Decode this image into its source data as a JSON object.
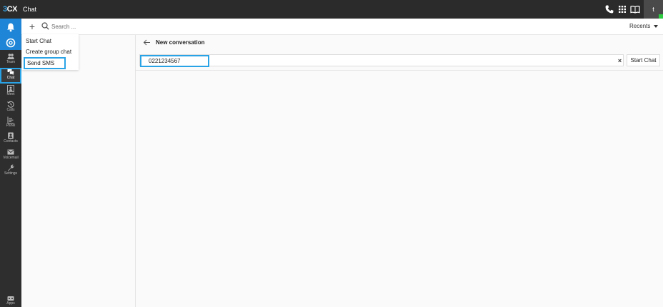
{
  "topbar": {
    "logo_prefix": "3",
    "logo_suffix": "CX",
    "title": "Chat",
    "user_initial": "t",
    "icons": [
      "phone-icon",
      "dialpad-icon",
      "book-icon"
    ]
  },
  "rail": {
    "items": [
      {
        "label": "Team",
        "icon": "team-icon"
      },
      {
        "label": "Chat",
        "icon": "chat-icon"
      },
      {
        "label": "Meet",
        "icon": "meet-icon"
      },
      {
        "label": "Calls",
        "icon": "history-icon"
      },
      {
        "label": "Panel",
        "icon": "panel-icon"
      },
      {
        "label": "Contacts",
        "icon": "contacts-icon"
      },
      {
        "label": "Voicemail",
        "icon": "voicemail-icon"
      },
      {
        "label": "Settings",
        "icon": "wrench-icon"
      }
    ],
    "apps_label": "Apps"
  },
  "search": {
    "placeholder": "Search ..."
  },
  "recents_label": "Recents",
  "dropdown": {
    "items": [
      "Start Chat",
      "Create group chat",
      "Send SMS"
    ]
  },
  "conversation": {
    "title": "New conversation",
    "recipient_value": "0221234567",
    "clear_label": "×",
    "start_button": "Start Chat"
  },
  "colors": {
    "accent": "#29a3e6",
    "topbar": "#2b2b2b",
    "rail": "#2e2e2e",
    "rail_top": "#1f85d6"
  }
}
